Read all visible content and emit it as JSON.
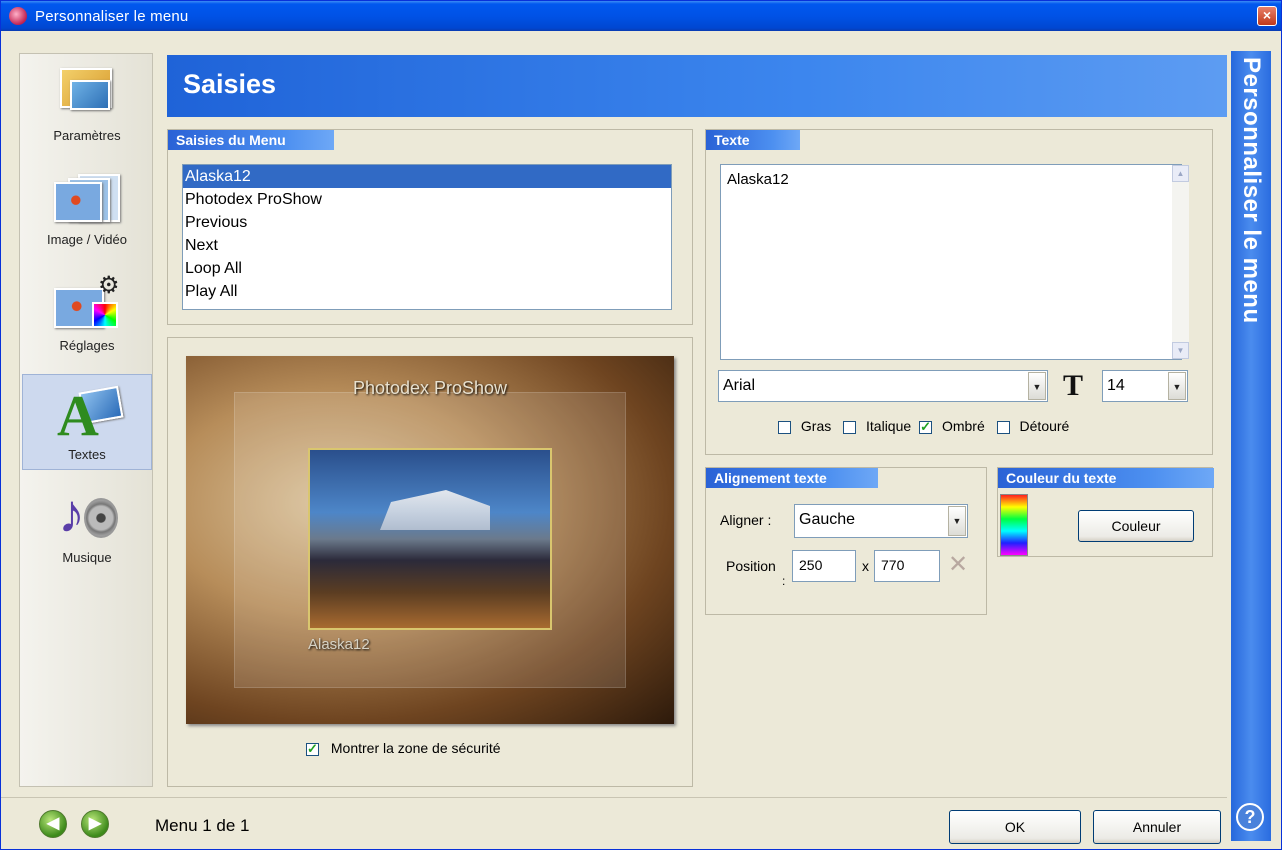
{
  "window": {
    "title": "Personnaliser le menu",
    "close_label": "×"
  },
  "nav": {
    "items": [
      {
        "label": "Paramètres",
        "icon": "settings-photos-icon",
        "active": false
      },
      {
        "label": "Image / Vidéo",
        "icon": "image-video-icon",
        "active": false
      },
      {
        "label": "Réglages",
        "icon": "adjustments-icon",
        "active": false
      },
      {
        "label": "Textes",
        "icon": "texts-icon",
        "active": true
      },
      {
        "label": "Musique",
        "icon": "music-icon",
        "active": false
      }
    ]
  },
  "header": {
    "title": "Saisies",
    "side_title": "Personnaliser le menu",
    "help": "?"
  },
  "menu_entries": {
    "group_title": "Saisies du Menu",
    "items": [
      "Alaska12",
      "Photodex ProShow",
      "Previous",
      "Next",
      "Loop All",
      "Play All"
    ],
    "selected_index": 0
  },
  "preview": {
    "title_text": "Photodex ProShow",
    "caption_text": "Alaska12",
    "safe_zone_label": "Montrer la zone de sécurité",
    "safe_zone_checked": true
  },
  "text_panel": {
    "group_title": "Texte",
    "value": "Alaska12",
    "font": "Arial",
    "size": "14",
    "bold_label": "Gras",
    "bold": false,
    "italic_label": "Italique",
    "italic": false,
    "shadow_label": "Ombré",
    "shadow": true,
    "outline_label": "Détouré",
    "outline": false
  },
  "alignment": {
    "group_title": "Alignement texte",
    "align_label": "Aligner :",
    "align_value": "Gauche",
    "position_label": "Position",
    "position_colon": ":",
    "x_value": "250",
    "separator": "x",
    "y_value": "770"
  },
  "color": {
    "group_title": "Couleur du texte",
    "button_label": "Couleur"
  },
  "footer": {
    "page_label": "Menu 1 de 1",
    "ok_label": "OK",
    "cancel_label": "Annuler"
  },
  "colors": {
    "title_blue": "#0052e6",
    "header_blue": "#3c86ee",
    "selection": "#316ac5",
    "face": "#ece9d8"
  }
}
